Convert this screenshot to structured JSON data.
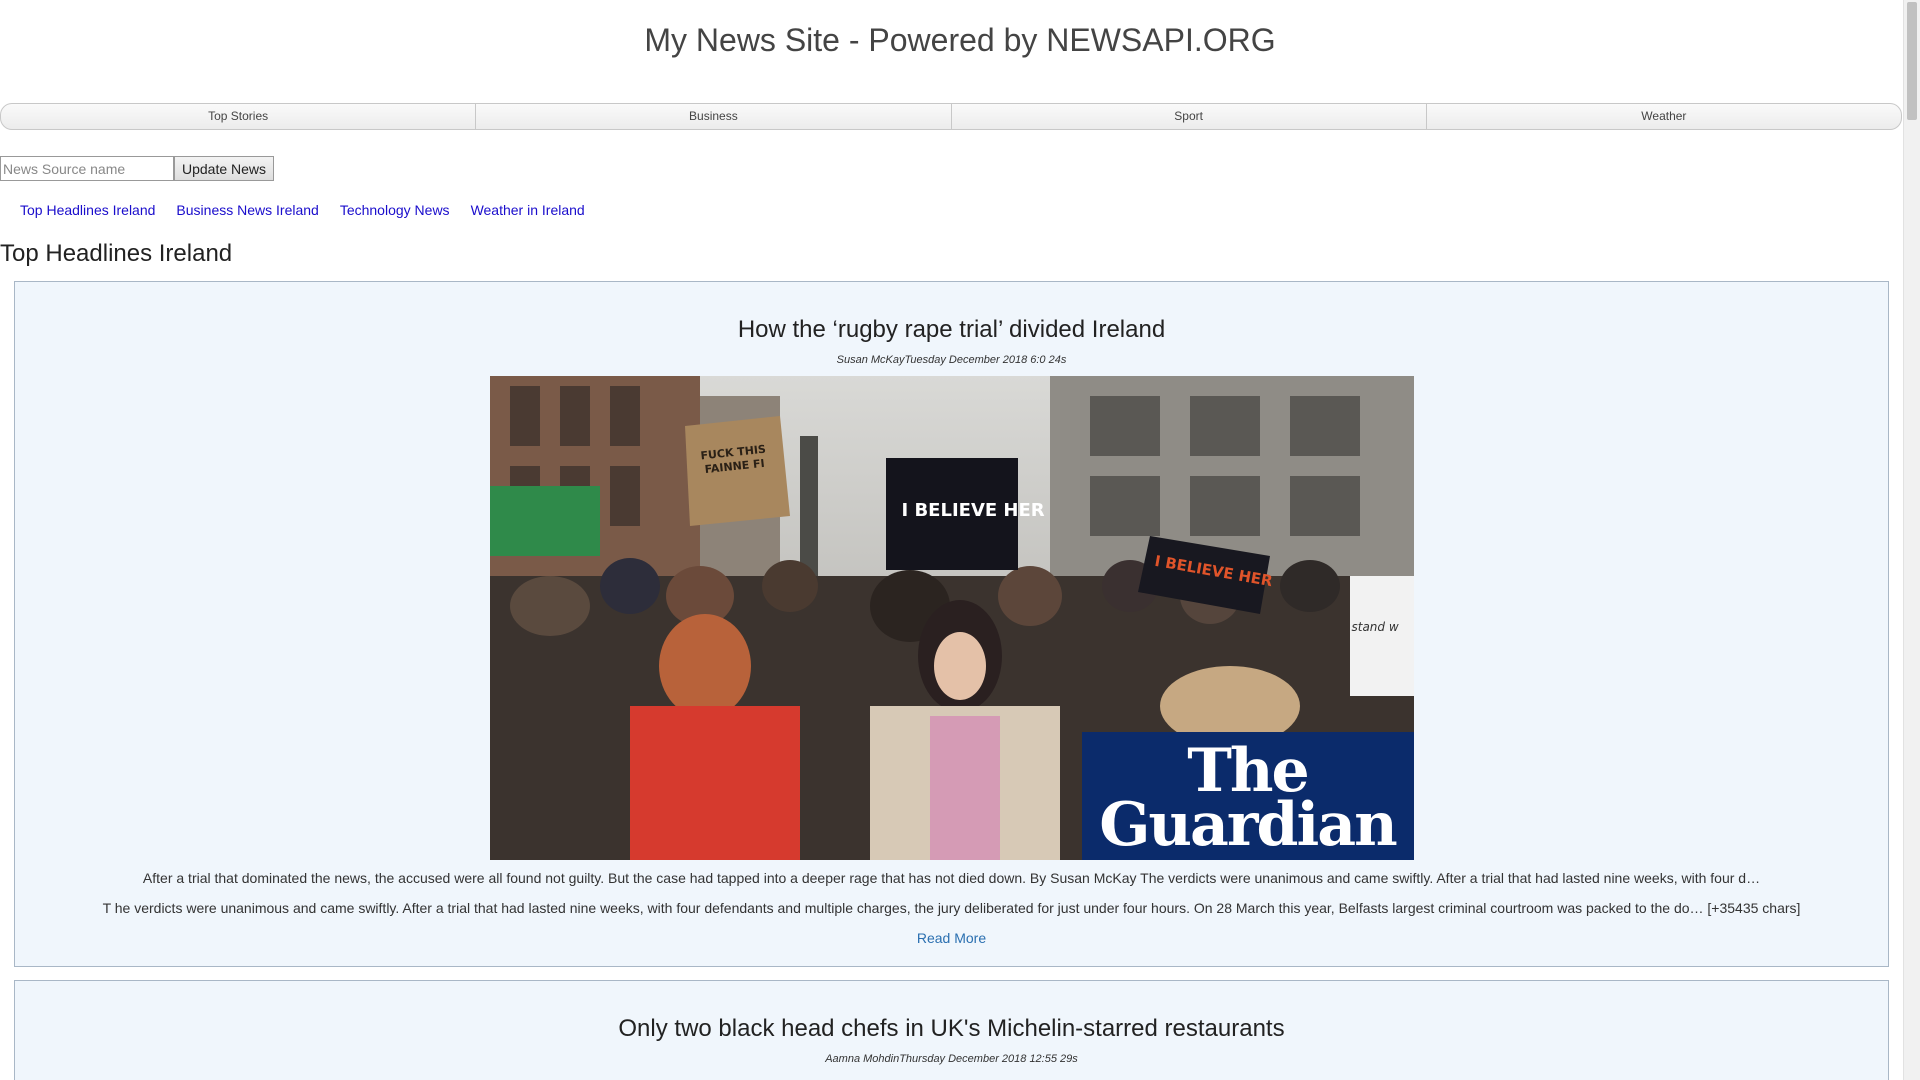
{
  "site": {
    "title": "My News Site - Powered by NEWSAPI.ORG"
  },
  "nav": {
    "items": [
      {
        "label": "Top Stories"
      },
      {
        "label": "Business"
      },
      {
        "label": "Sport"
      },
      {
        "label": "Weather"
      }
    ]
  },
  "search": {
    "placeholder": "News Source name",
    "value": "",
    "button_label": "Update News"
  },
  "feeds": {
    "links": [
      {
        "label": "Top Headlines Ireland"
      },
      {
        "label": "Business News Ireland"
      },
      {
        "label": "Technology News"
      },
      {
        "label": "Weather in Ireland"
      }
    ]
  },
  "section": {
    "title": "Top Headlines Ireland"
  },
  "articles": [
    {
      "title": "How the ‘rugby rape trial’ divided Ireland",
      "byline": "Susan McKayTuesday December 2018 6:0 24s",
      "image": {
        "signs": [
          "I BELIEVE HER",
          "I BELIEVE HER",
          "FUCK THIS FAINNE FI",
          "stand w"
        ],
        "watermark_line1": "The",
        "watermark_line2": "Guardian"
      },
      "description": "After a trial that dominated the news, the accused were all found not guilty. But the case had tapped into a deeper rage that has not died down. By Susan McKay The verdicts were unanimous and came swiftly. After a trial that had lasted nine weeks, with four d…",
      "content": "T he verdicts were unanimous and came swiftly. After a trial that had lasted nine weeks, with four defendants and multiple charges, the jury deliberated for just under four hours. On 28 March this year, Belfasts largest criminal courtroom was packed to the do… [+35435 chars]",
      "read_more": "Read More"
    },
    {
      "title": "Only two black head chefs in UK's Michelin-starred restaurants",
      "byline": "Aamna MohdinThursday December 2018 12:55 29s"
    }
  ],
  "colors": {
    "link": "#1a0dcc",
    "read_more": "#2a6fb0",
    "card_bg": "#f0f6fc",
    "card_border": "#a9b7c6",
    "guardian_blue": "#0b2b6b"
  }
}
